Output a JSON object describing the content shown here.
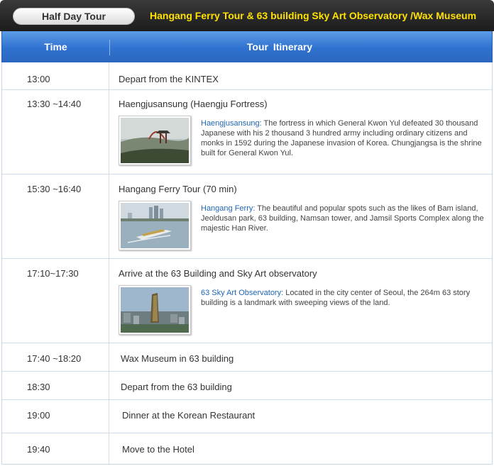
{
  "header": {
    "badge": "Half Day Tour",
    "title": "Hangang Ferry Tour & 63 building Sky Art Observatory /Wax Museum"
  },
  "columns": {
    "time": "Time",
    "itinerary": "Tour  Itinerary"
  },
  "rows": [
    {
      "time": "13:00",
      "event": "Depart from the KINTEX"
    },
    {
      "time": "13:30 ~14:40",
      "event": "Haengjusansung (Haengju Fortress)",
      "highlight": "Haengjusansung:",
      "description": " The fortress in which General Kwon Yul defeated 30 thousand Japanese with his  2 thousand 3 hundred army including ordinary citizens and monks in 1592 during the Japanese invasion of Korea.  Chungjangsa  is the shrine built for  General Kwon Yul.",
      "image": "fortress-pavilion-photo"
    },
    {
      "time": "15:30 ~16:40",
      "event": "Hangang Ferry Tour (70 min)",
      "highlight": "Hangang Ferry:",
      "description": " The beautiful and popular spots such as the likes of  Bam island, Jeoldusan park, 63 building, Namsan tower, and Jamsil Sports Complex along the majestic  Han River.",
      "image": "ferry-on-river-photo"
    },
    {
      "time": "17:10~17:30",
      "event": "Arrive at the 63 Building and Sky Art observatory",
      "highlight": "63 Sky Art Observatory:",
      "description": " Located in the city center of Seoul, the 264m 63 story building is a landmark with sweeping views of the land.",
      "image": "63-building-skyline-photo"
    },
    {
      "time": "17:40 ~18:20",
      "event": "Wax Museum in 63 building"
    },
    {
      "time": "18:30",
      "event": "Depart from the 63 building"
    },
    {
      "time": "19:00",
      "event": "Dinner at the Korean Restaurant"
    },
    {
      "time": "19:40",
      "event": "Move to the Hotel"
    }
  ],
  "colors": {
    "title_yellow": "#ffe100",
    "header_blue": "#2f72cf",
    "link_blue": "#1f66b7",
    "grid_line": "#cfdcee"
  }
}
